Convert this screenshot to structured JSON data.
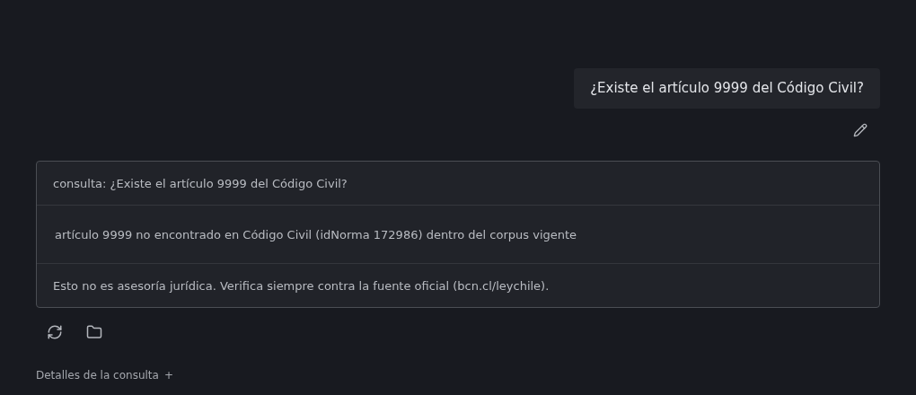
{
  "user_message": {
    "text": "¿Existe el artículo 9999 del Código Civil?"
  },
  "response_rows": [
    {
      "kind": "query",
      "text": "consulta: ¿Existe el artículo 9999 del Código Civil?"
    },
    {
      "kind": "result",
      "text": "artículo 9999 no encontrado en Código Civil (idNorma 172986) dentro del corpus vigente"
    },
    {
      "kind": "disclaimer",
      "text": "Esto no es asesoría jurídica. Verifica siempre contra la fuente oficial (bcn.cl/leychile)."
    }
  ],
  "details": {
    "label": "Detalles de la consulta",
    "toggle": "+"
  }
}
